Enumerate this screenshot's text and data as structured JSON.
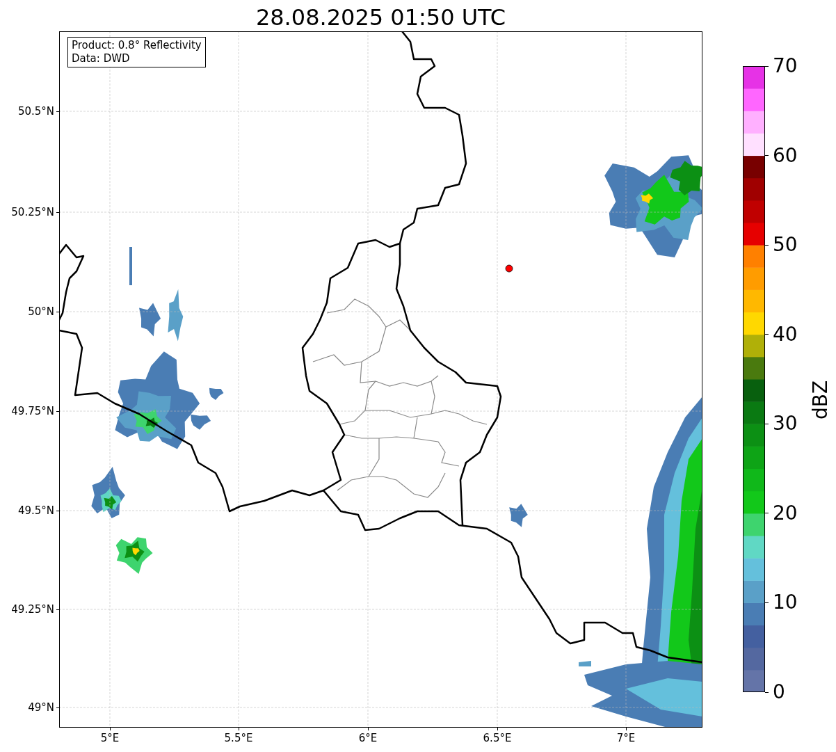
{
  "title": "28.08.2025 01:50 UTC",
  "info_box": [
    "Product: 0.8° Reflectivity",
    "Data: DWD"
  ],
  "y_ticks": [
    "50.5°N",
    "50.25°N",
    "50°N",
    "49.75°N",
    "49.5°N",
    "49.25°N",
    "49°N"
  ],
  "x_ticks": [
    "5°E",
    "5.5°E",
    "6°E",
    "6.5°E",
    "7°E"
  ],
  "colorbar": {
    "label": "dBZ",
    "ticks": [
      "70",
      "60",
      "50",
      "40",
      "30",
      "20",
      "10",
      "0"
    ],
    "segments": [
      {
        "color": "#6474a8"
      },
      {
        "color": "#5468a0"
      },
      {
        "color": "#4460a0"
      },
      {
        "color": "#4a7db4"
      },
      {
        "color": "#5aa0c8"
      },
      {
        "color": "#64c0dc"
      },
      {
        "color": "#60d8c4"
      },
      {
        "color": "#3ed46e"
      },
      {
        "color": "#12c81a"
      },
      {
        "color": "#10b81a"
      },
      {
        "color": "#0ea416"
      },
      {
        "color": "#0c9014"
      },
      {
        "color": "#0a7a12"
      },
      {
        "color": "#08600e"
      },
      {
        "color": "#4a7a0e"
      },
      {
        "color": "#b0b008"
      },
      {
        "color": "#ffd800"
      },
      {
        "color": "#ffb800"
      },
      {
        "color": "#ff9c00"
      },
      {
        "color": "#ff8000"
      },
      {
        "color": "#e60000"
      },
      {
        "color": "#c00000"
      },
      {
        "color": "#a00000"
      },
      {
        "color": "#780000"
      },
      {
        "color": "#ffe0ff"
      },
      {
        "color": "#ffb0ff"
      },
      {
        "color": "#ff66ff"
      },
      {
        "color": "#e632e6"
      }
    ]
  }
}
